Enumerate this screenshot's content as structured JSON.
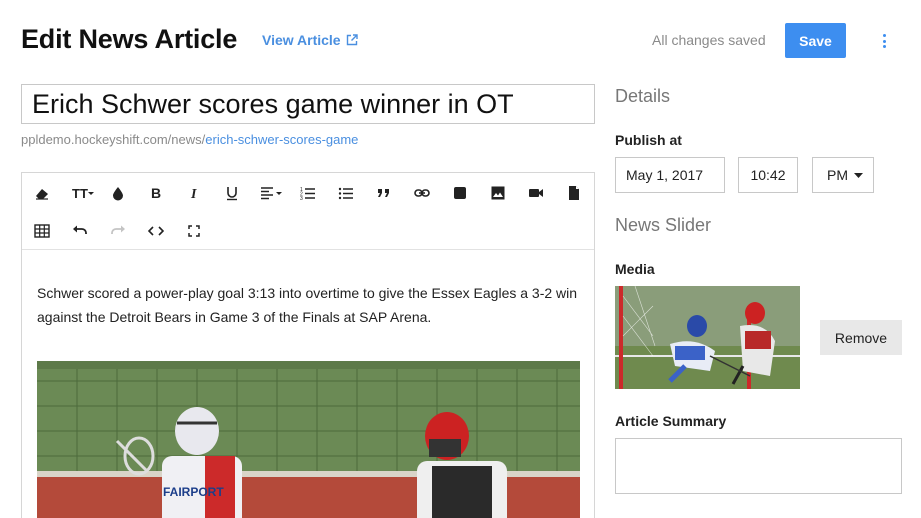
{
  "header": {
    "title": "Edit News Article",
    "view_link": "View Article",
    "status": "All changes saved",
    "save_label": "Save"
  },
  "article": {
    "title": "Erich Schwer scores game winner in OT",
    "url_base": "ppldemo.hockeyshift.com/news/",
    "url_slug": "erich-schwer-scores-game",
    "body": "Schwer scored a power-play goal 3:13 into overtime to give the Essex Eagles a 3-2 win against the Detroit Bears in Game 3 of the Finals at SAP Arena."
  },
  "toolbar": {
    "row1": [
      "eraser-icon",
      "text-size-icon",
      "color-icon",
      "bold-icon",
      "italic-icon",
      "underline-icon",
      "align-icon",
      "ordered-list-icon",
      "unordered-list-icon",
      "quote-icon",
      "link-icon",
      "block-icon",
      "image-icon",
      "video-icon",
      "file-icon"
    ],
    "row2": [
      "table-icon",
      "undo-icon",
      "redo-icon",
      "code-icon",
      "fullscreen-icon"
    ]
  },
  "details": {
    "heading": "Details",
    "publish_label": "Publish at",
    "date": "May 1, 2017",
    "time": "10:42",
    "ampm": "PM"
  },
  "slider": {
    "heading": "News Slider",
    "media_label": "Media",
    "remove_label": "Remove"
  },
  "summary": {
    "label": "Article Summary",
    "value": ""
  },
  "colors": {
    "accent": "#3d8ef0",
    "link": "#4a8fe0",
    "muted": "#8a8a8a"
  }
}
